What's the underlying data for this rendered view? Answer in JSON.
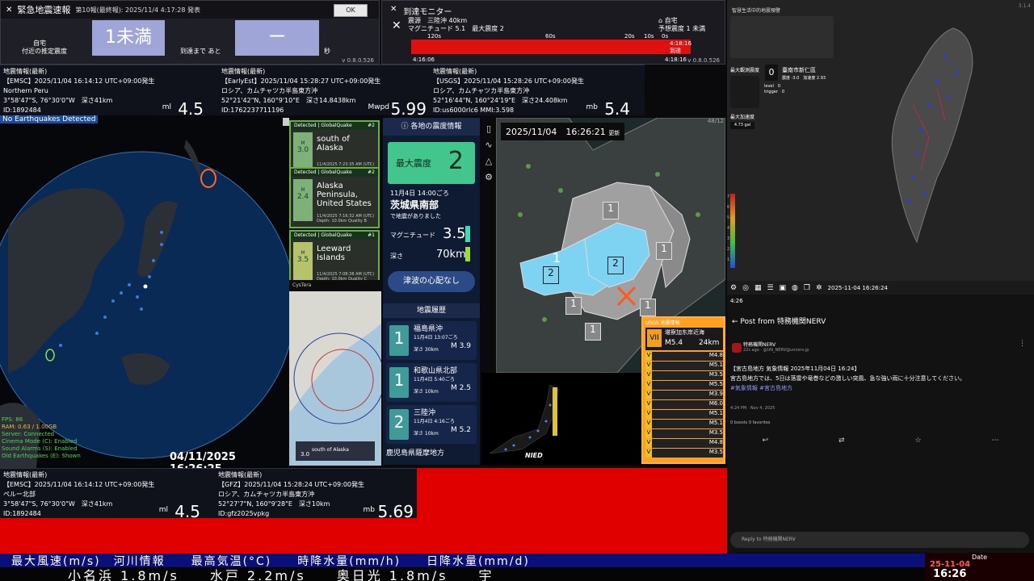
{
  "eew": {
    "title": "緊急地震速報",
    "report": "第10報(最終報): 2025/11/4 4:17:28 発表",
    "ok": "OK",
    "home_label": "自宅",
    "near_label": "付近の推定震度",
    "intensity": "1未満",
    "arrival_label": "到達まで あと",
    "arrival_value": "ー",
    "sec": "秒",
    "version": "v 0.8.0.526"
  },
  "monitor": {
    "title": "到達モニター",
    "epicenter": "震源　三陸沖 40km",
    "magnitude": "マグニチュード 5.1　最大震度 2",
    "home": "自宅",
    "est": "予想震度 1 未満",
    "ticks": [
      "120s",
      "60s",
      "20s",
      "10s",
      "0s"
    ],
    "time1": "4:18:16",
    "arrived": "到達",
    "start": "4:16:06",
    "end": "4:18:16",
    "version": "v 0.8.0.526"
  },
  "info_top": [
    {
      "title": "地震情報(最新)",
      "source": "【EMSC】2025/11/04 16:14:12 UTC+09:00発生",
      "place": "Northern Peru",
      "coords": "3°58'47\"S, 76°30'0\"W　深さ41km",
      "id": "ID:1892484",
      "scale": "ml",
      "mag": "4.5"
    },
    {
      "title": "地震情報(最新)",
      "source": "【EarlyEst】2025/11/04 15:28:27 UTC+09:00発生",
      "place": "ロシア、カムチャツカ半島東方沖",
      "coords": "52°21'42\"N, 160°9'10\"E　深さ14.8438km",
      "id": "ID:1762237711196",
      "scale": "Mwpd",
      "mag": "5.99"
    },
    {
      "title": "地震情報(最新)",
      "source": "【USGS】2025/11/04 15:28:26 UTC+09:00発生",
      "place": "ロシア、カムチャツカ半島東方沖",
      "coords": "52°16'44\"N, 160°24'19\"E　深さ24.408km",
      "id": "ID:us6000rlc6 MMI:3.598",
      "scale": "mb",
      "mag": "5.4"
    }
  ],
  "globe": {
    "status": "No Earthquakes Detected",
    "stats": [
      "FPS: 86",
      "RAM: 0.63 / 1.00GB",
      "Server: Connected",
      "Cinema Mode (C): Enabled",
      "Sound Alarms (S): Enabled",
      "Old Earthquakes (E): Shown"
    ],
    "timestamp": "04/11/2025 16:26:25"
  },
  "cards": [
    {
      "header": "Detected | GlobalQuake",
      "num": "#2",
      "mag": "3.0",
      "place": "south of Alaska",
      "meta": "11/4/2025 7:23:35 AM (UTC) Depth: 10.0km Quality C"
    },
    {
      "header": "Detected | GlobalQuake",
      "num": "#2",
      "mag": "2.4",
      "place": "Alaska Peninsula, United States",
      "meta": "11/4/2025 7:16:32 AM (UTC) Depth: 10.0km Quality B"
    },
    {
      "header": "Detected | GlobalQuake",
      "num": "#1",
      "mag": "3.5",
      "place": "Leeward Islands",
      "meta": "11/4/2025 7:08:38 AM (UTC) Depth: 10.0km Quality C"
    }
  ],
  "cystera": {
    "title": "CysTera",
    "place": "south of Alaska",
    "mag": "3.0"
  },
  "nerv": {
    "header": "各地の震度情報",
    "max_label": "最大震度",
    "max_value": "2",
    "datetime": "11月4日 14:00ごろ",
    "region": "茨城県南部",
    "occurred": "で地震がありました",
    "mag_label": "マグニチュード",
    "mag": "3.5",
    "depth_label": "深さ",
    "depth": "70km",
    "tsunami": "津波の心配なし",
    "history_title": "地震履歴",
    "history": [
      {
        "int": "1",
        "place": "福島県沖",
        "time": "11月4日 13:07ごろ",
        "depth": "深さ 30km",
        "mag": "M 3.9"
      },
      {
        "int": "1",
        "place": "和歌山県北部",
        "time": "11月4日 5:40ごろ",
        "depth": "深さ 10km",
        "mag": "M 2.5"
      },
      {
        "int": "2",
        "place": "三陸沖",
        "time": "11月4日 4:16ごろ",
        "depth": "深さ 10km",
        "mag": "M 5.2"
      },
      {
        "int": "",
        "place": "鹿児島県薩摩地方",
        "time": "",
        "depth": "",
        "mag": ""
      }
    ]
  },
  "jmap": {
    "datetime": "2025/11/04　16:26:21",
    "update": "更新",
    "corner": "48/12",
    "labels": [
      "1",
      "1",
      "2",
      "2",
      "1",
      "1",
      "1",
      "1"
    ]
  },
  "usgs": {
    "header": "USGS 地震情報",
    "int": "VII",
    "place": "堪察加东岸近海",
    "mag": "M5.4",
    "depth": "24km",
    "list": [
      {
        "int": "V",
        "mag": "M4.8"
      },
      {
        "int": "V",
        "mag": "M5.1"
      },
      {
        "int": "V",
        "mag": "M3.5"
      },
      {
        "int": "V",
        "mag": "M5.5"
      },
      {
        "int": "V",
        "mag": "M3.9"
      },
      {
        "int": "V",
        "mag": "M6.0"
      },
      {
        "int": "V",
        "mag": "M5.1"
      },
      {
        "int": "V",
        "mag": "M5.1"
      },
      {
        "int": "V",
        "mag": "M3.5"
      },
      {
        "int": "V",
        "mag": "M4.8"
      },
      {
        "int": "V",
        "mag": "M3.5"
      }
    ]
  },
  "nied": {
    "logo": "NIED"
  },
  "taiwan": {
    "title": "智慧生活中的地震預警",
    "version": "3.1.4",
    "max_intensity": "最大觀測震度",
    "count": "0",
    "station": "臺南市新仁區",
    "value": "震度 -3.0　加速度 2.93",
    "level": "level　0",
    "trigger": "trigger　0",
    "max_acc": "最大加速度",
    "gal": "4.73 gal",
    "scale": [
      "7",
      "6",
      "5",
      "4",
      "3",
      "2",
      "1"
    ],
    "timestamp": "2025-11-04 16:26:24"
  },
  "post": {
    "time": "4:26",
    "title": "Post from 特務機関NERV",
    "author": "特務機関NERV",
    "handle": "22s ago · @UN_NERV@unnerv.jp",
    "body1": "【宮古島地方 気象情報 2025年11月04日 16:24】",
    "body2": "宮古島地方では、5日は落雷や竜巻などの激しい突風、急な強い雨に十分注意してください。",
    "tags": "#気象情報 #宮古島地方",
    "meta": "4:24 PM · Nov 4, 2025",
    "stats": "0 boosts  0 favorites",
    "reply": "Reply to 特務機関NERV"
  },
  "info_bottom": [
    {
      "title": "地震情報(最新)",
      "source": "【EMSC】2025/11/04 16:14:12 UTC+09:00発生",
      "place": "ペルー北部",
      "coords": "3°58'47\"S, 76°30'0\"W　深さ41km",
      "id": "ID:1892484",
      "scale": "ml",
      "mag": "4.5"
    },
    {
      "title": "地震情報(最新)",
      "source": "【GFZ】2025/11/04 15:28:24 UTC+09:00発生",
      "place": "ロシア、カムチャツカ半島東方沖",
      "coords": "52°27'7\"N, 160°9'28\"E　深さ10km",
      "id": "ID:gfz2025vpkg",
      "scale": "mb",
      "mag": "5.69"
    }
  ],
  "ticker": {
    "top": "最大風速(m/s)　河川情報　　最高気温(°C)　　時降水量(mm/h)　　日降水量(mm/d)",
    "bottom": "小名浜 1.8m/s　　水戸 2.2m/s　　奥日光 1.8m/s　　宇"
  },
  "date": {
    "label": "Date",
    "day": "25-11-04",
    "time": "16:26"
  }
}
